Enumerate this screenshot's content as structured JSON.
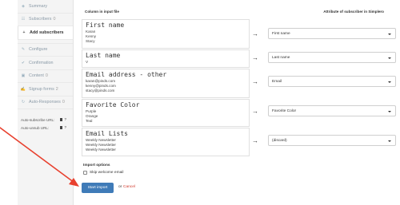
{
  "sidebar": {
    "items": [
      {
        "label": "Summary",
        "icon": "summary-icon",
        "glyph": "◈",
        "active": false
      },
      {
        "label": "Subscribers",
        "count": "0",
        "icon": "people-icon",
        "glyph": "☷",
        "active": false
      },
      {
        "label": "Add subscribers",
        "icon": "plus-icon",
        "glyph": "+",
        "active": true
      },
      {
        "label": "Configure",
        "icon": "wrench-icon",
        "glyph": "✎",
        "active": false
      },
      {
        "label": "Confirmation",
        "icon": "check-icon",
        "glyph": "✔",
        "active": false
      },
      {
        "label": "Content",
        "count": "0",
        "icon": "content-icon",
        "glyph": "▣",
        "active": false
      },
      {
        "label": "Signup forms",
        "count": "2",
        "icon": "form-icon",
        "glyph": "✍",
        "active": false
      },
      {
        "label": "Auto-Responses",
        "count": "0",
        "icon": "auto-icon",
        "glyph": "↻",
        "active": false
      }
    ],
    "auto_subscribe_label": "Auto-subscribe URL:",
    "auto_unsub_label": "Auto-unsub URL:"
  },
  "main": {
    "col_left_header": "Column in input file",
    "col_right_header": "Attribute of subscriber in Simplero",
    "arrow_glyph": "→",
    "fields": [
      {
        "title": "First name",
        "values": [
          "Karan",
          "Kenny",
          "Stacy"
        ],
        "mapped_to": "First name"
      },
      {
        "title": "Last name",
        "values": [
          "V"
        ],
        "mapped_to": "Last name"
      },
      {
        "title": "Email address - other",
        "values": [
          "karan@pinds.com",
          "kenny@pinds.com",
          "stacy@pinds.com"
        ],
        "mapped_to": "Email"
      },
      {
        "title": "Favorite Color",
        "values": [
          "Purple",
          "Orange",
          "Teal"
        ],
        "mapped_to": "Favorite Color"
      },
      {
        "title": "Email Lists",
        "values": [
          "Weekly Newsletter",
          "Weekly Newsletter",
          "Weekly Newsletter"
        ],
        "mapped_to": "(discard)"
      }
    ],
    "import_options_title": "Import options",
    "skip_welcome_label": "Skip welcome email",
    "start_button_label": "Start import",
    "or_text": "or",
    "cancel_label": "Cancel"
  },
  "colors": {
    "accent": "#3f7bb8",
    "cancel": "#d0382b",
    "annotation_arrow": "#e8412f"
  }
}
